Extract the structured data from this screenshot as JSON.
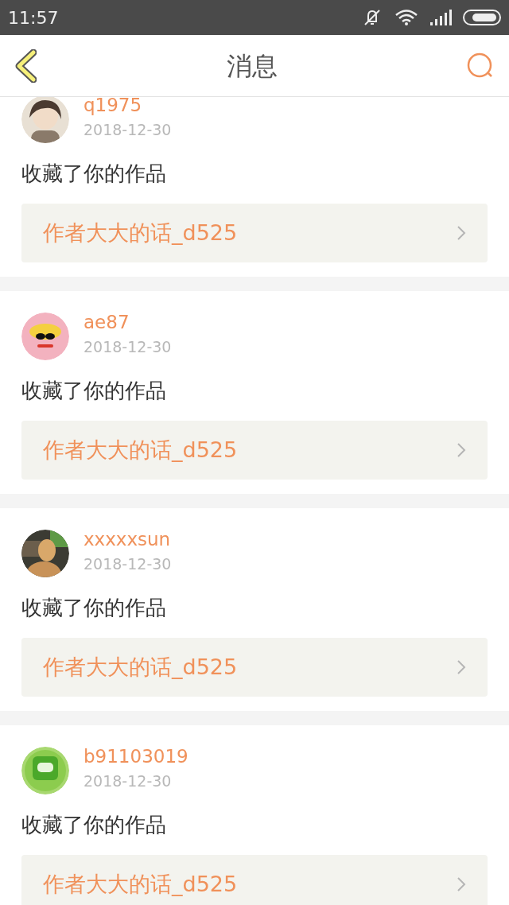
{
  "status_bar": {
    "time": "11:57"
  },
  "header": {
    "title": "消息"
  },
  "messages": [
    {
      "user": "q1975",
      "date": "2018-12-30",
      "action": "收藏了你的作品",
      "work": "作者大大的话_d525"
    },
    {
      "user": "ae87",
      "date": "2018-12-30",
      "action": "收藏了你的作品",
      "work": "作者大大的话_d525"
    },
    {
      "user": "xxxxxsun",
      "date": "2018-12-30",
      "action": "收藏了你的作品",
      "work": "作者大大的话_d525"
    },
    {
      "user": "b91103019",
      "date": "2018-12-30",
      "action": "收藏了你的作品",
      "work": "作者大大的话_d525"
    }
  ]
}
